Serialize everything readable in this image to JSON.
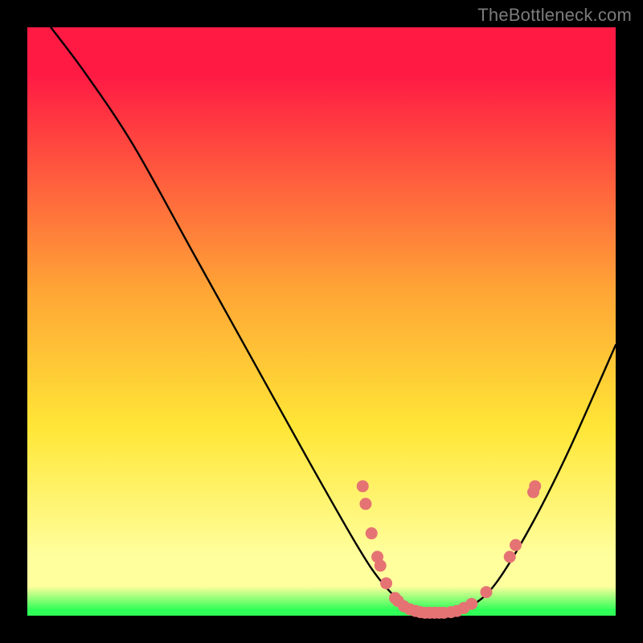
{
  "watermark": "TheBottleneck.com",
  "colors": {
    "red": "#ff1a44",
    "orange": "#ffa636",
    "yellow": "#ffe636",
    "pale": "#ffff9e",
    "green": "#2fff57",
    "curve": "#000000",
    "dot": "#e57373"
  },
  "chart_data": {
    "type": "line",
    "title": "",
    "xlabel": "",
    "ylabel": "",
    "xlim": [
      0,
      100
    ],
    "ylim": [
      0,
      100
    ],
    "grid": false,
    "legend": false,
    "note": "Values are read approximately from the figure. y=100 is top of the plot area, y=0 is bottom. x runs left→right.",
    "curve_points": [
      {
        "x": 4,
        "y": 100
      },
      {
        "x": 10,
        "y": 92
      },
      {
        "x": 18,
        "y": 80
      },
      {
        "x": 28,
        "y": 62
      },
      {
        "x": 38,
        "y": 44
      },
      {
        "x": 48,
        "y": 26
      },
      {
        "x": 56,
        "y": 12
      },
      {
        "x": 60,
        "y": 6
      },
      {
        "x": 64,
        "y": 2
      },
      {
        "x": 68,
        "y": 0.5
      },
      {
        "x": 72,
        "y": 0.5
      },
      {
        "x": 76,
        "y": 2
      },
      {
        "x": 80,
        "y": 6
      },
      {
        "x": 86,
        "y": 16
      },
      {
        "x": 92,
        "y": 28
      },
      {
        "x": 100,
        "y": 46
      }
    ],
    "marker_points": [
      {
        "x": 57,
        "y": 22
      },
      {
        "x": 57.5,
        "y": 19
      },
      {
        "x": 58.5,
        "y": 14
      },
      {
        "x": 59.5,
        "y": 10
      },
      {
        "x": 60,
        "y": 8.5
      },
      {
        "x": 61,
        "y": 5.5
      },
      {
        "x": 62.5,
        "y": 3
      },
      {
        "x": 63,
        "y": 2.5
      },
      {
        "x": 64,
        "y": 1.6
      },
      {
        "x": 65,
        "y": 1.1
      },
      {
        "x": 66,
        "y": 0.8
      },
      {
        "x": 66.8,
        "y": 0.6
      },
      {
        "x": 67.6,
        "y": 0.5
      },
      {
        "x": 68.4,
        "y": 0.5
      },
      {
        "x": 69.2,
        "y": 0.5
      },
      {
        "x": 70,
        "y": 0.5
      },
      {
        "x": 70.8,
        "y": 0.5
      },
      {
        "x": 72,
        "y": 0.6
      },
      {
        "x": 73,
        "y": 0.8
      },
      {
        "x": 74.2,
        "y": 1.3
      },
      {
        "x": 75.5,
        "y": 2
      },
      {
        "x": 78,
        "y": 4
      },
      {
        "x": 82,
        "y": 10
      },
      {
        "x": 83,
        "y": 12
      },
      {
        "x": 86,
        "y": 21
      },
      {
        "x": 86.3,
        "y": 22
      }
    ]
  }
}
